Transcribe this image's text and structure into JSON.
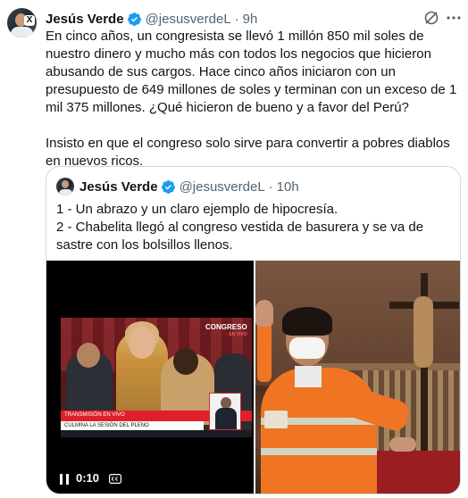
{
  "tweet": {
    "name": "Jesús Verde",
    "handle": "@jesusverdeL",
    "separator": "·",
    "time": "9h",
    "paragraphs": [
      "En cinco años, un congresista se llevó 1 millón 850 mil soles de nuestro dinero y mucho más con todos los negocios que hicieron abusando de sus cargos.  Hace cinco años iniciaron con un presupuesto de 649 millones de soles y terminan con un exceso de 1 mil 375 millones. ¿Qué hicieron de bueno y a favor del Perú?",
      "Insisto en que el congreso solo sirve para convertir a pobres diablos en nuevos ricos."
    ]
  },
  "quote": {
    "name": "Jesús Verde",
    "handle": "@jesusverdeL",
    "separator": "·",
    "time": "10h",
    "lines": [
      "1 - Un abrazo y un claro ejemplo de hipocresía.",
      "2 - Chabelita llegó al congreso vestida de basurera y se va de sastre con los bolsillos llenos."
    ],
    "video": {
      "timecode": "0:10",
      "channel_logo": "CONGRESO",
      "channel_sub": "EN VIVO",
      "lower_bar_text": "TRANSMISIÓN EN VIVO",
      "lower_title": "CULMINA LA SESIÓN DEL PLENO"
    }
  },
  "icons": {
    "verified": "verified-badge-icon",
    "grok": "grok-icon",
    "more": "more-icon",
    "pause": "pause-icon",
    "cc": "closed-captions-icon"
  },
  "colors": {
    "verified_blue": "#1d9bf0",
    "secondary_text": "#536471",
    "border": "#cfd9de"
  }
}
